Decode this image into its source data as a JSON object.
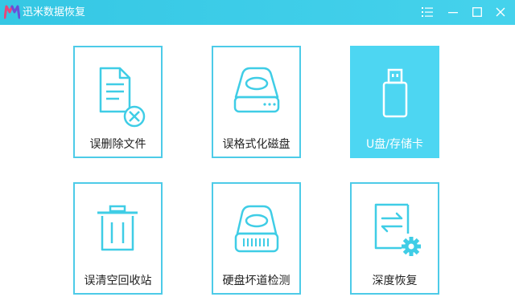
{
  "window": {
    "title": "迅米数据恢复",
    "controls": [
      "menu-icon",
      "minimize-icon",
      "maximize-icon",
      "close-icon"
    ]
  },
  "tiles": [
    {
      "label": "误删除文件",
      "icon": "deleted-file-icon",
      "selected": false
    },
    {
      "label": "误格式化磁盘",
      "icon": "hard-disk-icon",
      "selected": false
    },
    {
      "label": "U盘/存储卡",
      "icon": "usb-drive-icon",
      "selected": true
    },
    {
      "label": "误清空回收站",
      "icon": "recycle-bin-icon",
      "selected": false
    },
    {
      "label": "硬盘坏道检测",
      "icon": "disk-scan-icon",
      "selected": false
    },
    {
      "label": "深度恢复",
      "icon": "deep-recovery-icon",
      "selected": false
    }
  ],
  "colors": {
    "titlebar": "#3ccbe8",
    "accent": "#4dcbe8",
    "selected_tile": "#4dd6f2",
    "label_text": "#222222"
  }
}
